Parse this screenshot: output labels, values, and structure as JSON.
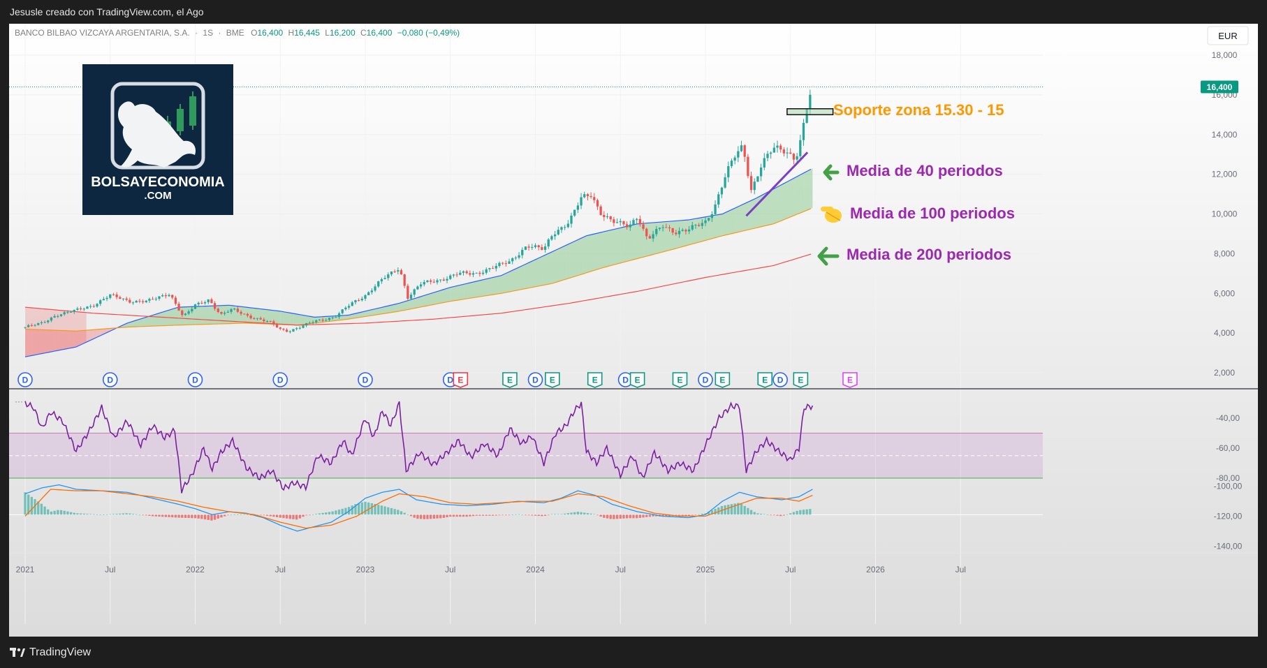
{
  "window": {
    "caption": "Jesusle creado con TradingView.com, el Ago"
  },
  "footer": {
    "brand": "TradingView"
  },
  "symbol": {
    "name": "BANCO BILBAO VIZCAYA ARGENTARIA, S.A.",
    "interval": "1S",
    "exchange": "BME",
    "o_label": "O",
    "o": "16,400",
    "h_label": "H",
    "h": "16,445",
    "l_label": "L",
    "l": "16,200",
    "c_label": "C",
    "c": "16,400",
    "change": "−0,080 (−0,49%)"
  },
  "currency": "EUR",
  "last_price_label": "16,400",
  "logo": {
    "line1": "BOLSAYECONOMIA",
    "line2": ".COM"
  },
  "annotations": {
    "support": "Soporte zona 15.30 - 15",
    "ma40": "Media de 40 periodos",
    "ma100": "Media de 100 periodos",
    "ma200": "Media de 200 periodos"
  },
  "events": {
    "dividend": "D",
    "earnings": "E"
  },
  "colors": {
    "up": "#26a69a",
    "down": "#ef5350",
    "ma40": "#2962ff",
    "ma100": "#f59b1c",
    "ma200": "#f24b4b",
    "rsi": "#7b1fa2",
    "annotation_purple": "#9c27b0",
    "annotation_orange": "#ff9800",
    "arrow_green": "#43a047"
  },
  "chart_data": {
    "type": "candlestick",
    "price_axis": {
      "range": [
        1500,
        19000
      ],
      "ticks": [
        "18,000",
        "16,000",
        "14,000",
        "12,000",
        "10,000",
        "8,000",
        "6,000",
        "4,000",
        "2,000"
      ]
    },
    "time_axis": {
      "ticks": [
        "2021",
        "Jul",
        "2022",
        "Jul",
        "2023",
        "Jul",
        "2024",
        "Jul",
        "2025",
        "Jul",
        "2026",
        "Jul"
      ]
    },
    "price_path": [
      [
        2021.0,
        4.3
      ],
      [
        2021.1,
        4.5
      ],
      [
        2021.18,
        4.9
      ],
      [
        2021.28,
        5.1
      ],
      [
        2021.4,
        5.4
      ],
      [
        2021.5,
        5.9
      ],
      [
        2021.62,
        5.6
      ],
      [
        2021.72,
        5.6
      ],
      [
        2021.85,
        6.0
      ],
      [
        2021.93,
        4.8
      ],
      [
        2022.0,
        5.4
      ],
      [
        2022.08,
        5.7
      ],
      [
        2022.15,
        4.9
      ],
      [
        2022.22,
        5.2
      ],
      [
        2022.33,
        4.8
      ],
      [
        2022.45,
        4.5
      ],
      [
        2022.5,
        4.2
      ],
      [
        2022.55,
        4.1
      ],
      [
        2022.62,
        4.3
      ],
      [
        2022.7,
        4.6
      ],
      [
        2022.82,
        4.8
      ],
      [
        2022.92,
        5.5
      ],
      [
        2023.0,
        5.9
      ],
      [
        2023.1,
        6.7
      ],
      [
        2023.2,
        7.3
      ],
      [
        2023.25,
        5.8
      ],
      [
        2023.33,
        6.5
      ],
      [
        2023.45,
        6.7
      ],
      [
        2023.55,
        7.0
      ],
      [
        2023.65,
        7.0
      ],
      [
        2023.75,
        7.3
      ],
      [
        2023.85,
        7.6
      ],
      [
        2023.95,
        8.4
      ],
      [
        2024.05,
        8.2
      ],
      [
        2024.1,
        9.0
      ],
      [
        2024.2,
        9.6
      ],
      [
        2024.27,
        10.8
      ],
      [
        2024.33,
        11.0
      ],
      [
        2024.38,
        10.1
      ],
      [
        2024.45,
        9.6
      ],
      [
        2024.55,
        9.4
      ],
      [
        2024.6,
        9.9
      ],
      [
        2024.66,
        8.7
      ],
      [
        2024.75,
        9.4
      ],
      [
        2024.82,
        9.1
      ],
      [
        2024.9,
        9.2
      ],
      [
        2025.0,
        9.6
      ],
      [
        2025.05,
        10.3
      ],
      [
        2025.12,
        12.0
      ],
      [
        2025.18,
        13.0
      ],
      [
        2025.22,
        13.4
      ],
      [
        2025.27,
        11.2
      ],
      [
        2025.33,
        12.5
      ],
      [
        2025.4,
        13.3
      ],
      [
        2025.47,
        13.2
      ],
      [
        2025.53,
        12.8
      ],
      [
        2025.56,
        13.7
      ],
      [
        2025.6,
        15.5
      ],
      [
        2025.63,
        16.4
      ]
    ],
    "moving_averages": [
      {
        "name": "Media de 40 periodos",
        "path": [
          [
            2021.0,
            2.8
          ],
          [
            2021.3,
            3.3
          ],
          [
            2021.6,
            4.5
          ],
          [
            2021.9,
            5.3
          ],
          [
            2022.2,
            5.4
          ],
          [
            2022.5,
            5.1
          ],
          [
            2022.7,
            4.8
          ],
          [
            2022.9,
            4.9
          ],
          [
            2023.2,
            5.5
          ],
          [
            2023.5,
            6.3
          ],
          [
            2023.8,
            6.9
          ],
          [
            2024.0,
            7.7
          ],
          [
            2024.3,
            8.9
          ],
          [
            2024.6,
            9.5
          ],
          [
            2024.9,
            9.7
          ],
          [
            2025.1,
            10.0
          ],
          [
            2025.3,
            10.8
          ],
          [
            2025.63,
            12.3
          ]
        ]
      },
      {
        "name": "Media de 100 periodos",
        "path": [
          [
            2021.0,
            4.2
          ],
          [
            2021.3,
            4.1
          ],
          [
            2021.6,
            4.3
          ],
          [
            2021.9,
            4.4
          ],
          [
            2022.3,
            4.5
          ],
          [
            2022.6,
            4.4
          ],
          [
            2022.9,
            4.7
          ],
          [
            2023.2,
            5.1
          ],
          [
            2023.5,
            5.6
          ],
          [
            2023.8,
            6.0
          ],
          [
            2024.1,
            6.5
          ],
          [
            2024.4,
            7.3
          ],
          [
            2024.8,
            8.2
          ],
          [
            2025.1,
            8.9
          ],
          [
            2025.4,
            9.5
          ],
          [
            2025.63,
            10.3
          ]
        ]
      },
      {
        "name": "Media de 200 periodos",
        "path": [
          [
            2021.0,
            5.3
          ],
          [
            2021.4,
            5.0
          ],
          [
            2021.8,
            4.8
          ],
          [
            2022.2,
            4.6
          ],
          [
            2022.6,
            4.4
          ],
          [
            2023.0,
            4.5
          ],
          [
            2023.4,
            4.7
          ],
          [
            2023.8,
            5.0
          ],
          [
            2024.2,
            5.5
          ],
          [
            2024.6,
            6.1
          ],
          [
            2025.0,
            6.8
          ],
          [
            2025.4,
            7.4
          ],
          [
            2025.63,
            8.0
          ]
        ]
      }
    ],
    "support_zone": [
      15.0,
      15.3
    ],
    "dividend_dates": [
      2021.0,
      2021.5,
      2022.0,
      2022.5,
      2023.0,
      2023.5,
      2024.0,
      2024.53,
      2025.0,
      2025.44
    ],
    "earnings_dates": [
      2023.56,
      2023.85,
      2024.1,
      2024.35,
      2024.6,
      2024.85,
      2025.1,
      2025.35,
      2025.56,
      2025.85
    ],
    "rsi": {
      "axis_ticks": [
        "-40,00",
        "-60,00",
        "-80,00"
      ],
      "range": [
        -100,
        -20
      ],
      "band": [
        -80,
        -50
      ],
      "path": [
        [
          2021.0,
          -30
        ],
        [
          2021.05,
          -33
        ],
        [
          2021.1,
          -47
        ],
        [
          2021.15,
          -36
        ],
        [
          2021.22,
          -42
        ],
        [
          2021.3,
          -62
        ],
        [
          2021.38,
          -48
        ],
        [
          2021.45,
          -33
        ],
        [
          2021.52,
          -53
        ],
        [
          2021.6,
          -42
        ],
        [
          2021.68,
          -58
        ],
        [
          2021.75,
          -45
        ],
        [
          2021.82,
          -53
        ],
        [
          2021.88,
          -48
        ],
        [
          2021.92,
          -88
        ],
        [
          2021.98,
          -78
        ],
        [
          2022.05,
          -60
        ],
        [
          2022.1,
          -74
        ],
        [
          2022.15,
          -63
        ],
        [
          2022.22,
          -55
        ],
        [
          2022.3,
          -73
        ],
        [
          2022.38,
          -80
        ],
        [
          2022.45,
          -75
        ],
        [
          2022.52,
          -87
        ],
        [
          2022.58,
          -83
        ],
        [
          2022.65,
          -86
        ],
        [
          2022.72,
          -65
        ],
        [
          2022.8,
          -70
        ],
        [
          2022.87,
          -55
        ],
        [
          2022.92,
          -65
        ],
        [
          2023.0,
          -40
        ],
        [
          2023.05,
          -53
        ],
        [
          2023.1,
          -35
        ],
        [
          2023.15,
          -45
        ],
        [
          2023.2,
          -30
        ],
        [
          2023.24,
          -75
        ],
        [
          2023.32,
          -63
        ],
        [
          2023.4,
          -71
        ],
        [
          2023.48,
          -63
        ],
        [
          2023.55,
          -55
        ],
        [
          2023.62,
          -66
        ],
        [
          2023.7,
          -57
        ],
        [
          2023.78,
          -65
        ],
        [
          2023.85,
          -47
        ],
        [
          2023.92,
          -57
        ],
        [
          2023.98,
          -52
        ],
        [
          2024.05,
          -70
        ],
        [
          2024.12,
          -50
        ],
        [
          2024.18,
          -45
        ],
        [
          2024.23,
          -35
        ],
        [
          2024.27,
          -30
        ],
        [
          2024.3,
          -62
        ],
        [
          2024.36,
          -70
        ],
        [
          2024.42,
          -60
        ],
        [
          2024.5,
          -78
        ],
        [
          2024.57,
          -65
        ],
        [
          2024.63,
          -80
        ],
        [
          2024.7,
          -63
        ],
        [
          2024.78,
          -75
        ],
        [
          2024.85,
          -70
        ],
        [
          2024.93,
          -75
        ],
        [
          2025.0,
          -58
        ],
        [
          2025.08,
          -40
        ],
        [
          2025.15,
          -32
        ],
        [
          2025.2,
          -32
        ],
        [
          2025.24,
          -75
        ],
        [
          2025.3,
          -62
        ],
        [
          2025.36,
          -55
        ],
        [
          2025.43,
          -62
        ],
        [
          2025.5,
          -68
        ],
        [
          2025.55,
          -60
        ],
        [
          2025.58,
          -33
        ],
        [
          2025.63,
          -32
        ]
      ]
    },
    "macd": {
      "axis_ticks": [
        "-100,00",
        "-120,00",
        "-140,00"
      ],
      "range": [
        -145,
        -95
      ],
      "zero": -119,
      "macd_path": [
        [
          2021.0,
          -105
        ],
        [
          2021.1,
          -101
        ],
        [
          2021.2,
          -99
        ],
        [
          2021.3,
          -102
        ],
        [
          2021.45,
          -103
        ],
        [
          2021.6,
          -104
        ],
        [
          2021.75,
          -108
        ],
        [
          2021.9,
          -112
        ],
        [
          2022.0,
          -115
        ],
        [
          2022.1,
          -119
        ],
        [
          2022.2,
          -117
        ],
        [
          2022.3,
          -118
        ],
        [
          2022.4,
          -121
        ],
        [
          2022.5,
          -126
        ],
        [
          2022.6,
          -130
        ],
        [
          2022.7,
          -127
        ],
        [
          2022.8,
          -124
        ],
        [
          2022.9,
          -117
        ],
        [
          2023.0,
          -108
        ],
        [
          2023.1,
          -104
        ],
        [
          2023.2,
          -102
        ],
        [
          2023.3,
          -109
        ],
        [
          2023.45,
          -112
        ],
        [
          2023.6,
          -113
        ],
        [
          2023.75,
          -112
        ],
        [
          2023.9,
          -110
        ],
        [
          2024.05,
          -111
        ],
        [
          2024.15,
          -108
        ],
        [
          2024.25,
          -103
        ],
        [
          2024.35,
          -106
        ],
        [
          2024.45,
          -112
        ],
        [
          2024.6,
          -117
        ],
        [
          2024.75,
          -120
        ],
        [
          2024.9,
          -121
        ],
        [
          2025.0,
          -119
        ],
        [
          2025.1,
          -110
        ],
        [
          2025.2,
          -104
        ],
        [
          2025.3,
          -107
        ],
        [
          2025.45,
          -109
        ],
        [
          2025.55,
          -107
        ],
        [
          2025.63,
          -102
        ]
      ],
      "signal_path": [
        [
          2021.0,
          -120
        ],
        [
          2021.15,
          -102
        ],
        [
          2021.3,
          -103
        ],
        [
          2021.45,
          -103
        ],
        [
          2021.6,
          -105
        ],
        [
          2021.75,
          -107
        ],
        [
          2021.9,
          -110
        ],
        [
          2022.05,
          -114
        ],
        [
          2022.2,
          -117
        ],
        [
          2022.35,
          -119
        ],
        [
          2022.5,
          -124
        ],
        [
          2022.65,
          -128
        ],
        [
          2022.8,
          -126
        ],
        [
          2022.95,
          -120
        ],
        [
          2023.1,
          -110
        ],
        [
          2023.2,
          -105
        ],
        [
          2023.35,
          -107
        ],
        [
          2023.5,
          -111
        ],
        [
          2023.65,
          -112
        ],
        [
          2023.8,
          -111
        ],
        [
          2023.95,
          -110
        ],
        [
          2024.1,
          -110
        ],
        [
          2024.25,
          -105
        ],
        [
          2024.4,
          -107
        ],
        [
          2024.55,
          -113
        ],
        [
          2024.7,
          -118
        ],
        [
          2024.85,
          -120
        ],
        [
          2025.0,
          -120
        ],
        [
          2025.15,
          -114
        ],
        [
          2025.3,
          -108
        ],
        [
          2025.45,
          -108
        ],
        [
          2025.55,
          -110
        ],
        [
          2025.63,
          -106
        ]
      ]
    }
  }
}
